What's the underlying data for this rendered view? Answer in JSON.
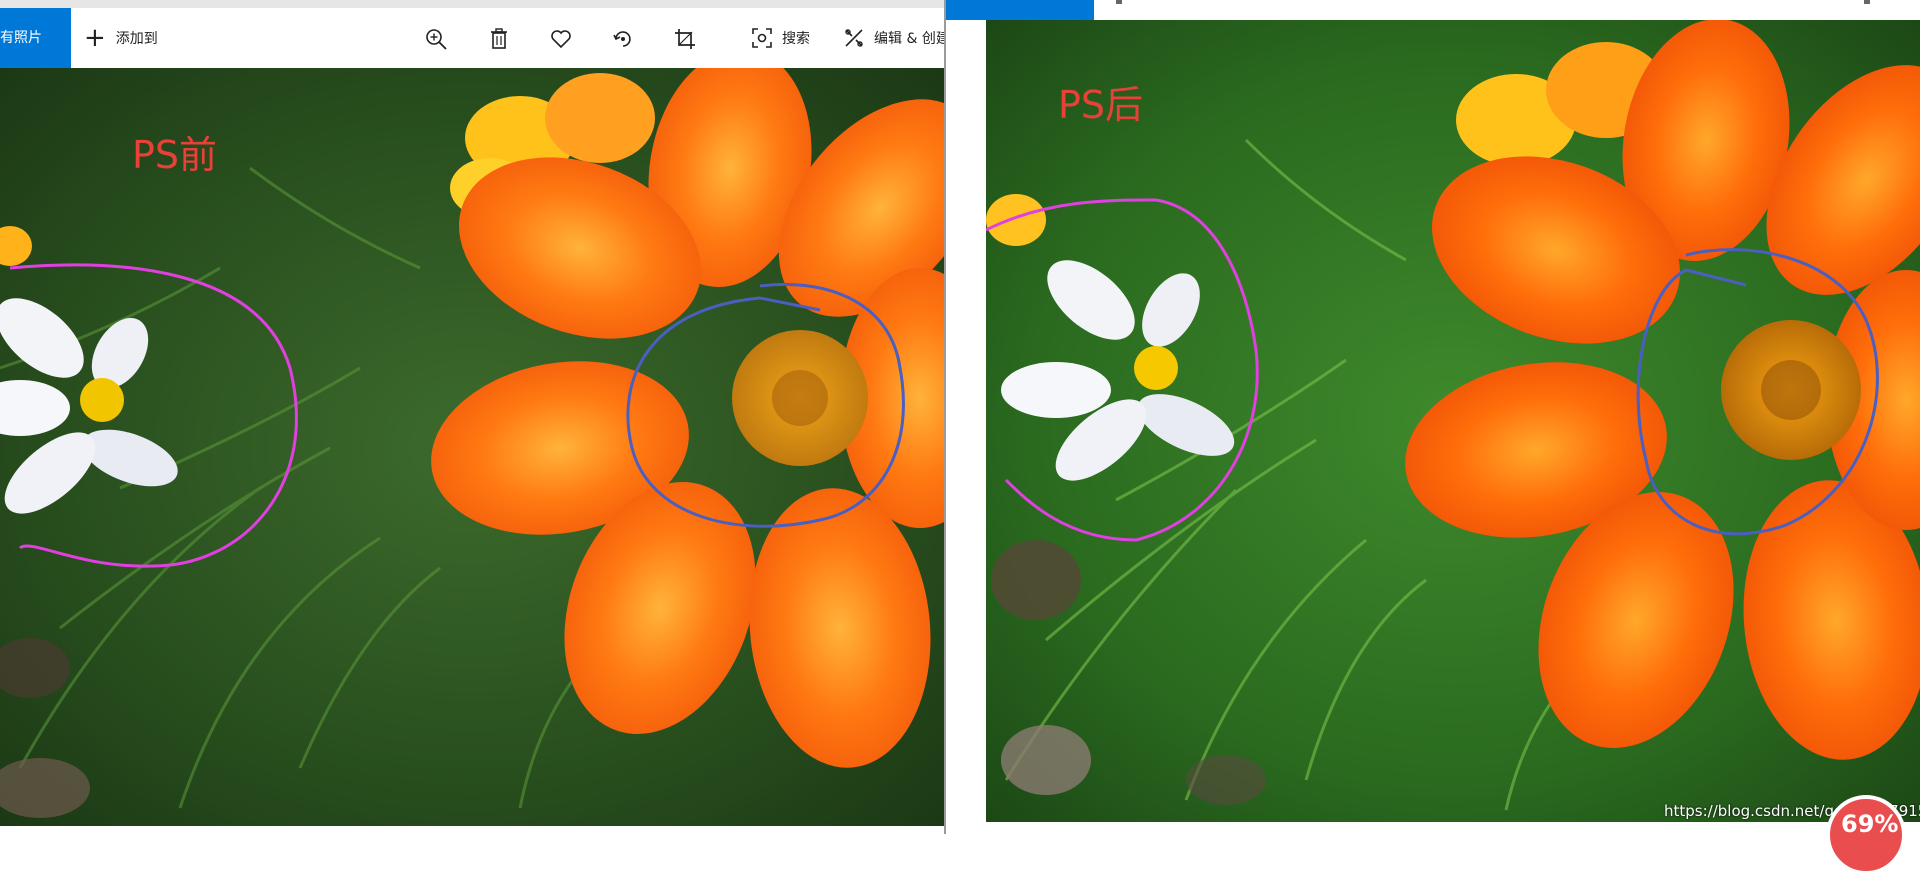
{
  "left_window": {
    "toolbar": {
      "all_photos": "所有照片",
      "add_to": "添加到",
      "search": "搜索",
      "edit_create": "编辑 & 创建"
    },
    "annotation": "PS前"
  },
  "right_window": {
    "annotation": "PS后"
  },
  "watermark": "https://blog.csdn.net/qq_45527915",
  "badge": "69%",
  "colors": {
    "accent": "#0078d7",
    "circle_white_flower": "#e040e0",
    "circle_orange_flower": "#4a5fc0",
    "annotation_text": "#e8413a"
  }
}
